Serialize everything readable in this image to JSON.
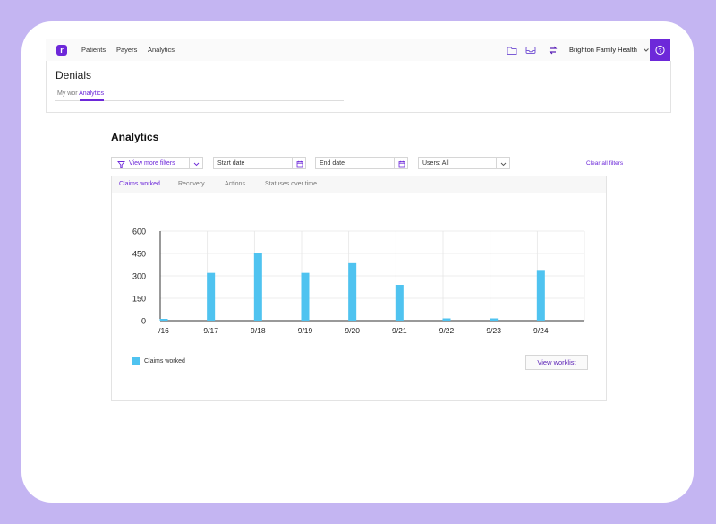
{
  "nav": {
    "links": [
      "Patients",
      "Payers",
      "Analytics"
    ],
    "org_name": "Brighton Family Health"
  },
  "page": {
    "title": "Denials",
    "breadcrumb_1": "My wor",
    "breadcrumb_2": "Analytics"
  },
  "analytics": {
    "heading": "Analytics",
    "filters": {
      "view_more": "View more filters",
      "start_date": "Start date",
      "end_date": "End date",
      "users": "Users: All",
      "clear": "Clear all filters"
    },
    "tabs": [
      "Claims worked",
      "Recovery",
      "Actions",
      "Statuses over time"
    ],
    "active_tab": "Claims worked",
    "view_worklist": "View worklist"
  },
  "colors": {
    "accent": "#6d28d9",
    "bar": "#4fc3f0"
  },
  "chart_data": {
    "type": "bar",
    "categories": [
      "/16",
      "9/17",
      "9/18",
      "9/19",
      "9/20",
      "9/21",
      "9/22",
      "9/23",
      "9/24"
    ],
    "series": [
      {
        "name": "Claims worked",
        "values": [
          12,
          320,
          455,
          320,
          385,
          240,
          15,
          15,
          340
        ]
      }
    ],
    "ylim": [
      0,
      600
    ],
    "yticks": [
      "600",
      "450",
      "300",
      "150",
      "0"
    ],
    "grid": true,
    "legend": "bottom-left"
  }
}
